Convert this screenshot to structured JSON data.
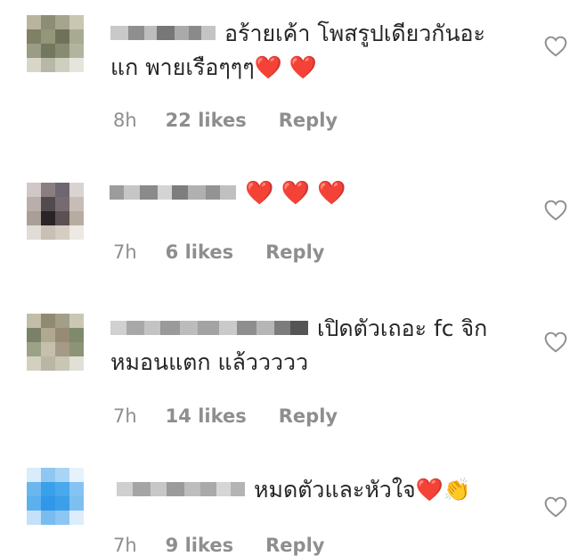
{
  "comments": [
    {
      "text_line1": "อร้ายเค้า โพสรูปเดียวกันอะ",
      "text_line2": "แก พายเรือๆๆๆ❤️ ❤️",
      "time": "8h",
      "likes": "22 likes",
      "reply": "Reply"
    },
    {
      "text_line1": "❤️ ❤️ ❤️",
      "time": "7h",
      "likes": "6 likes",
      "reply": "Reply"
    },
    {
      "text_line1": "เปิดตัวเถอะ fc จิก",
      "text_line2": "หมอนแตก แล้ววววว",
      "time": "7h",
      "likes": "14 likes",
      "reply": "Reply"
    },
    {
      "text_line1": "หมดตัวและหัวใจ❤️👏",
      "time": "7h",
      "likes": "9 likes",
      "reply": "Reply"
    }
  ],
  "icons": {
    "like": "heart-outline-icon"
  },
  "colors": {
    "meta_text": "#8e8e8e",
    "body_text": "#262626",
    "heart_emoji": "#e0242b"
  }
}
